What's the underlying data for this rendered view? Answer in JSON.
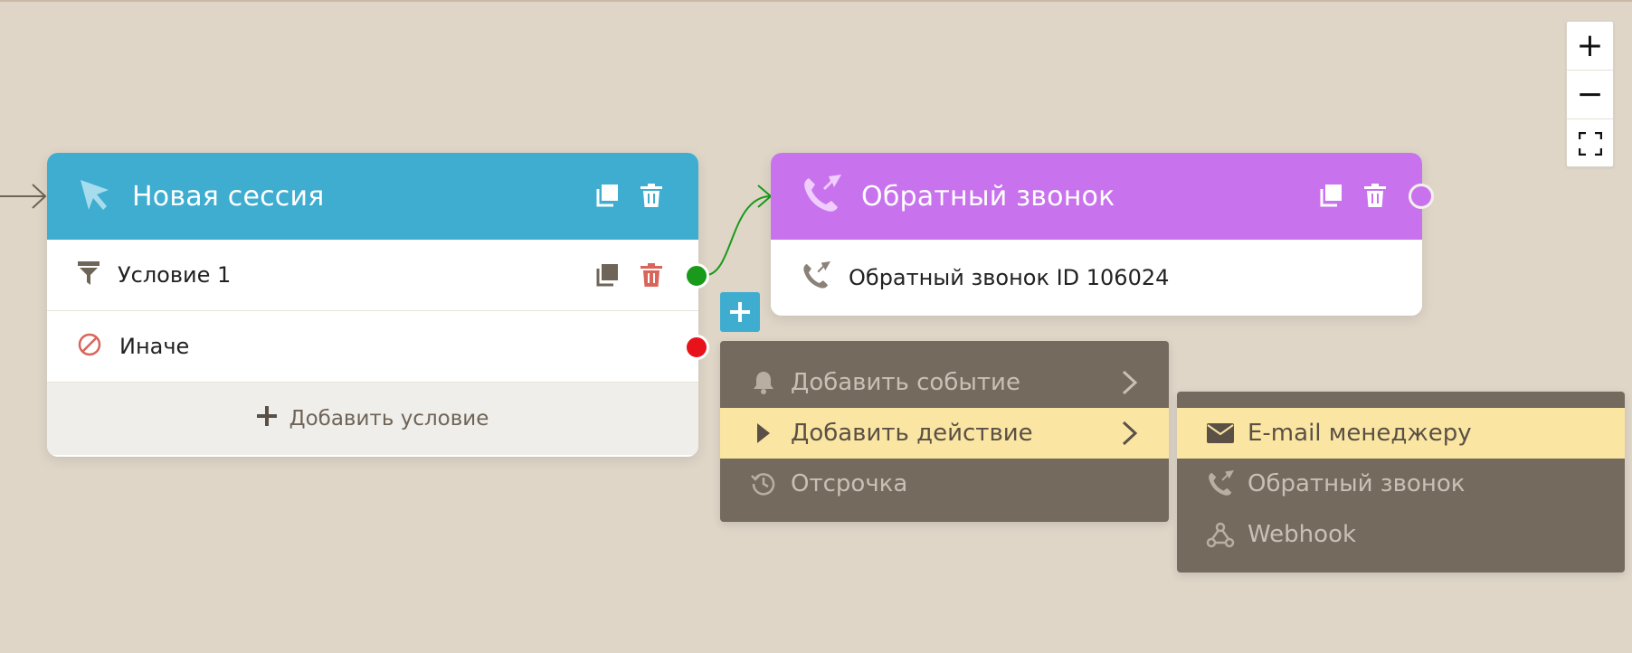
{
  "zoom": {
    "in_label": "+",
    "out_label": "−"
  },
  "session_node": {
    "title": "Новая сессия",
    "conditions": [
      {
        "label": "Условие 1"
      },
      {
        "label": "Иначе"
      }
    ],
    "add_condition_label": "Добавить условие"
  },
  "callback_node": {
    "title": "Обратный звонок",
    "row_label": "Обратный звонок ID 106024"
  },
  "plus_label": "+",
  "add_menu": {
    "items": [
      {
        "label": "Добавить событие",
        "icon": "bell-icon"
      },
      {
        "label": "Добавить действие",
        "icon": "play-icon"
      },
      {
        "label": "Отсрочка",
        "icon": "history-icon"
      }
    ]
  },
  "action_submenu": {
    "items": [
      {
        "label": "E-mail менеджеру",
        "icon": "envelope-icon"
      },
      {
        "label": "Обратный звонок",
        "icon": "phone-callback-icon"
      },
      {
        "label": "Webhook",
        "icon": "webhook-icon"
      }
    ]
  },
  "colors": {
    "background": "#dfd6c8",
    "session_header": "#3eadd0",
    "callback_header": "#c873ed",
    "port_true": "#1a9a1a",
    "port_false": "#e8121b",
    "menu_bg": "#756a5e",
    "menu_active": "#fae6a2",
    "delete_red": "#d9645a"
  }
}
